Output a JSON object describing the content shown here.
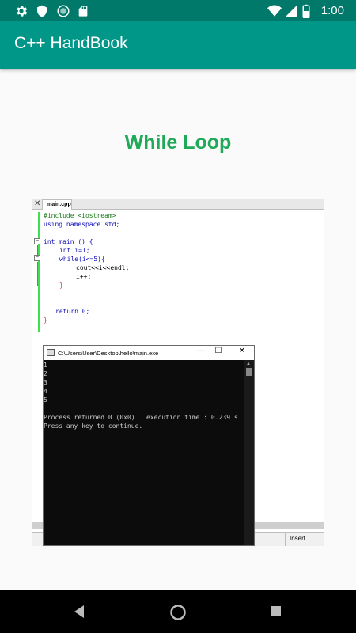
{
  "status_bar": {
    "time": "1:00",
    "icons": [
      "gear-icon",
      "shield-icon",
      "circle-icon",
      "sd-card-icon",
      "wifi-icon",
      "signal-icon",
      "battery-icon"
    ]
  },
  "app_bar": {
    "title": "C++ HandBook"
  },
  "content": {
    "heading": "While Loop",
    "editor": {
      "tab_close": "✕",
      "tab_name": "main.cpp",
      "code": [
        "#include <iostream>",
        "using namespace std;",
        "int main () {",
        "int i=1;",
        "while(i<=5){",
        "cout<<i<<endl;",
        "i++;",
        "}",
        "return 0;",
        "}"
      ],
      "status_mode": "Insert"
    },
    "console": {
      "title": "C:\\Users\\User\\Desktop\\hello\\main.exe",
      "output": [
        "1",
        "2",
        "3",
        "4",
        "5",
        "",
        "Process returned 0 (0x0)   execution time : 0.239 s",
        "Press any key to continue."
      ],
      "buttons": {
        "minimize": "—",
        "maximize": "☐",
        "close": "✕"
      }
    }
  },
  "colors": {
    "status_bar": "#00796b",
    "app_bar": "#009688",
    "heading": "#1faa59",
    "console_bg": "#0c0c0c"
  },
  "nav_bar": {
    "icons": [
      "back-icon",
      "home-icon",
      "recents-icon"
    ]
  }
}
